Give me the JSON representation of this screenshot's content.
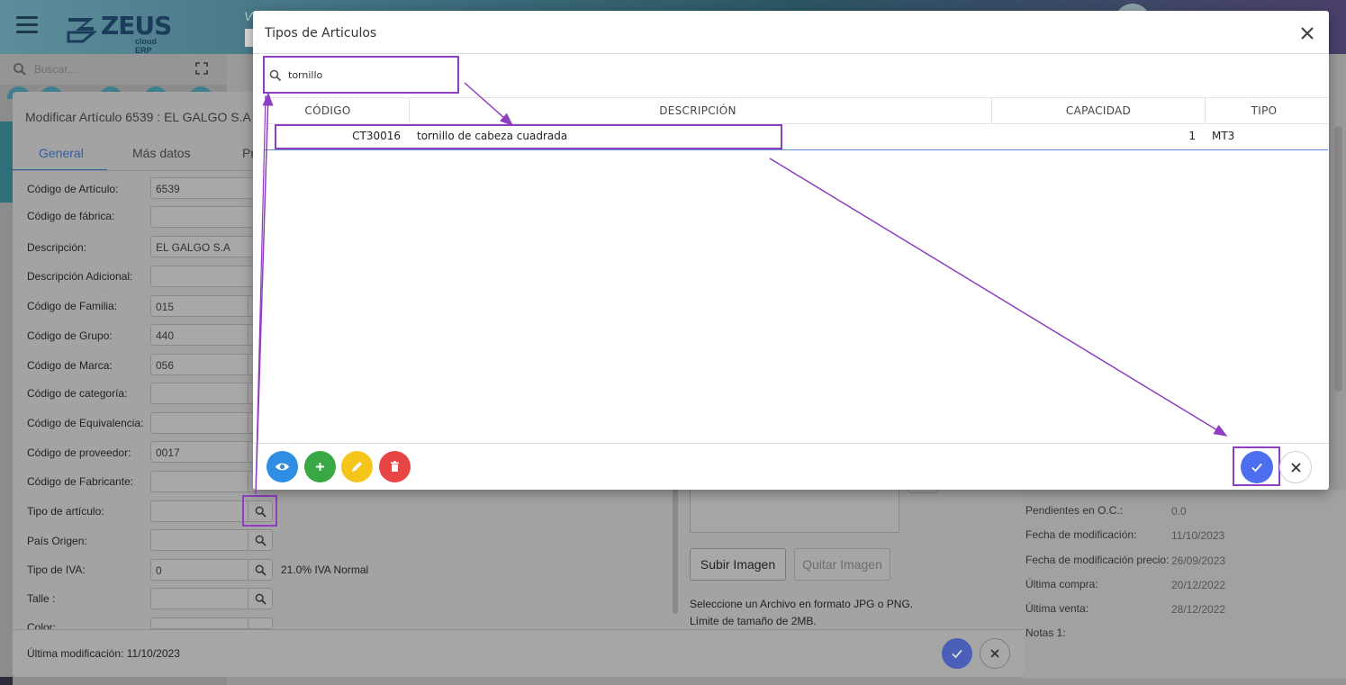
{
  "app": {
    "logo_text": "ZEUS",
    "logo_sub": "cloud ERP",
    "top_letter": "V",
    "side_search_placeholder": "Buscar..."
  },
  "form": {
    "title": "Modificar Artículo 6539 : EL GALGO S.A",
    "tabs": [
      {
        "label": "General",
        "active": true
      },
      {
        "label": "Más datos",
        "active": false
      },
      {
        "label": "Pr",
        "active": false
      }
    ],
    "fields": [
      {
        "label": "Código de Artículo:",
        "value": "6539"
      },
      {
        "label": "Código de fábrica:",
        "value": ""
      },
      {
        "label": "Descripción:",
        "value": "EL GALGO S.A"
      },
      {
        "label": "Descripción Adicional:",
        "value": ""
      },
      {
        "label": "Código de Familia:",
        "value": "015"
      },
      {
        "label": "Código de Grupo:",
        "value": "440"
      },
      {
        "label": "Código de Marca:",
        "value": "056"
      },
      {
        "label": "Código de categoría:",
        "value": ""
      },
      {
        "label": "Código de Equivalencia:",
        "value": ""
      },
      {
        "label": "Código de proveedor:",
        "value": "0017"
      },
      {
        "label": "Código de Fabricante:",
        "value": ""
      },
      {
        "label": "Tipo de artículo:",
        "value": ""
      },
      {
        "label": "País Origen:",
        "value": ""
      },
      {
        "label": "Tipo de IVA:",
        "value": "0"
      },
      {
        "label": "Talle :",
        "value": ""
      },
      {
        "label": "Color:",
        "value": ""
      }
    ],
    "iva_text": "21.0% IVA Normal",
    "btn_subir": "Subir Imagen",
    "btn_quitar": "Quitar Imagen",
    "img_note_1": "Seleccione un Archivo en formato JPG o PNG.",
    "img_note_2": "Límite de tamaño de 2MB.",
    "footer_text": "Última modificación: 11/10/2023"
  },
  "right_panel": [
    {
      "label": "Pendientes en O.C.:",
      "value": "0.0"
    },
    {
      "label": "Fecha de modificación:",
      "value": "11/10/2023"
    },
    {
      "label": "Fecha de modificación precio:",
      "value": "26/09/2023"
    },
    {
      "label": "Última compra:",
      "value": "20/12/2022"
    },
    {
      "label": "Última venta:",
      "value": "28/12/2022"
    },
    {
      "label": "Notas 1:",
      "value": ""
    }
  ],
  "dialog": {
    "title": "Tipos de Articulos",
    "search_value": "tornillo",
    "columns": [
      "CÓDIGO",
      "DESCRIPCIÓN",
      "CAPACIDAD",
      "TIPO"
    ],
    "rows": [
      {
        "codigo": "CT30016",
        "descripcion": "tornillo de cabeza cuadrada",
        "capacidad": "1",
        "tipo": "MT3"
      }
    ]
  },
  "colors": {
    "accent_blue": "#4e6ef0",
    "view_blue": "#2f8de4",
    "add_green": "#3aa745",
    "edit_yellow": "#f4c51b",
    "delete_red": "#e84545",
    "annotation_purple": "#8e3ec0"
  }
}
